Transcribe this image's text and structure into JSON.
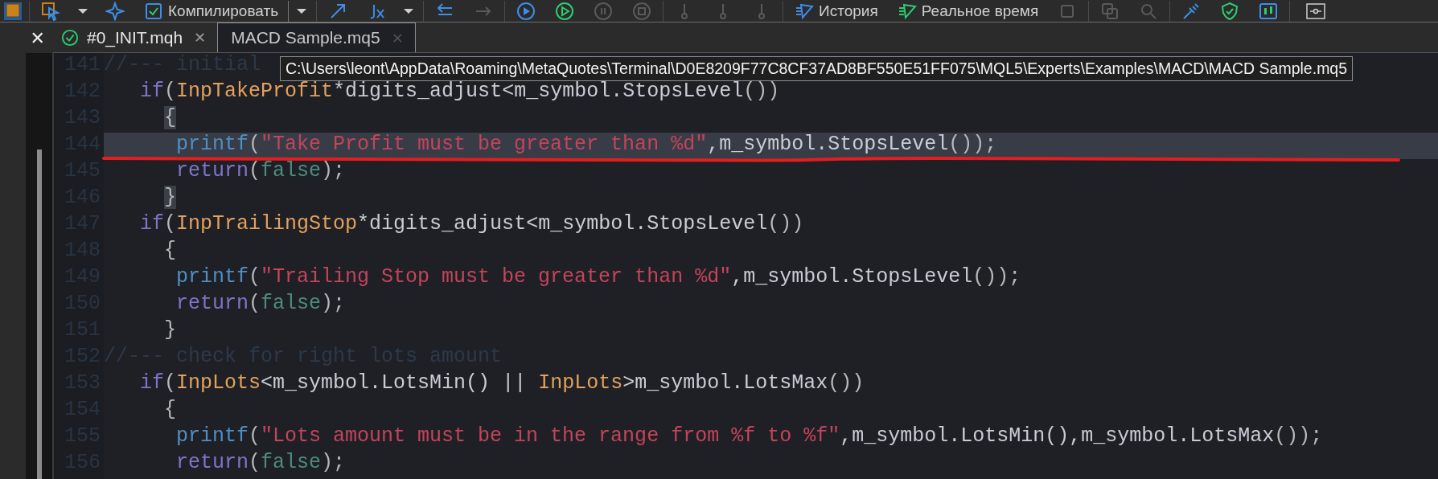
{
  "toolbar": {
    "items": [
      {
        "kind": "tile"
      },
      {
        "kind": "separator"
      },
      {
        "kind": "cursor",
        "disabled": false
      },
      {
        "kind": "caret",
        "disabled": false
      },
      {
        "kind": "sparkle",
        "disabled": false
      },
      {
        "kind": "compile",
        "label": "Компилировать",
        "disabled": false
      },
      {
        "kind": "split-caret",
        "disabled": false
      },
      {
        "kind": "separator"
      },
      {
        "kind": "arrow",
        "disabled": false
      },
      {
        "kind": "function",
        "disabled": false
      },
      {
        "kind": "caret",
        "disabled": false
      },
      {
        "kind": "separator"
      },
      {
        "kind": "back",
        "disabled": false
      },
      {
        "kind": "forward",
        "disabled": true
      },
      {
        "kind": "separator"
      },
      {
        "kind": "play",
        "disabled": false
      },
      {
        "kind": "play-green",
        "disabled": false
      },
      {
        "kind": "pause",
        "disabled": true
      },
      {
        "kind": "stop",
        "disabled": true
      },
      {
        "kind": "separator"
      },
      {
        "kind": "step",
        "disabled": true
      },
      {
        "kind": "step",
        "disabled": true
      },
      {
        "kind": "step",
        "disabled": true
      },
      {
        "kind": "separator"
      },
      {
        "kind": "history",
        "label": "История",
        "disabled": false
      },
      {
        "kind": "realtime",
        "label": "Реальное время",
        "disabled": false
      },
      {
        "kind": "square",
        "disabled": true
      },
      {
        "kind": "separator"
      },
      {
        "kind": "copy",
        "disabled": true
      },
      {
        "kind": "search",
        "disabled": true
      },
      {
        "kind": "separator"
      },
      {
        "kind": "brush",
        "disabled": false
      },
      {
        "kind": "shield",
        "disabled": false
      },
      {
        "kind": "chart",
        "disabled": false
      },
      {
        "kind": "separator"
      },
      {
        "kind": "box"
      }
    ]
  },
  "side_panel": {
    "close": "✕"
  },
  "tabs": [
    {
      "label": "#0_INIT.mqh",
      "close": "✕",
      "selected": false,
      "compiled": true
    },
    {
      "label": "MACD Sample.mq5",
      "close": "✕",
      "selected": true,
      "compiled": false
    }
  ],
  "tooltip": "C:\\Users\\leont\\AppData\\Roaming\\MetaQuotes\\Terminal\\D0E8209F77C8CF37AD8BF550E51FF075\\MQL5\\Experts\\Examples\\MACD\\MACD Sample.mq5",
  "editor": {
    "lines": [
      {
        "number": "141",
        "current": false,
        "tokens": [
          {
            "kind": "comment",
            "text": "//--- initial"
          }
        ]
      },
      {
        "number": "142",
        "current": false,
        "tokens": [
          {
            "kind": "keyword",
            "text": "   if"
          },
          {
            "kind": "paren",
            "text": "("
          },
          {
            "kind": "input",
            "text": "InpTakeProfit"
          },
          {
            "kind": "plain",
            "text": "*digits_adjust<m_symbol.StopsLevel"
          },
          {
            "kind": "paren",
            "text": "())"
          }
        ]
      },
      {
        "number": "143",
        "current": false,
        "tokens": [
          {
            "kind": "brace-match",
            "text": "     {"
          }
        ]
      },
      {
        "number": "144",
        "current": true,
        "tokens": [
          {
            "kind": "function",
            "text": "      printf"
          },
          {
            "kind": "paren",
            "text": "("
          },
          {
            "kind": "string",
            "text": "\"Take Profit must be greater than %d\""
          },
          {
            "kind": "plain",
            "text": ",m_symbol.StopsLevel"
          },
          {
            "kind": "paren",
            "text": "());"
          }
        ]
      },
      {
        "number": "145",
        "current": false,
        "tokens": [
          {
            "kind": "keyword",
            "text": "      return"
          },
          {
            "kind": "paren",
            "text": "("
          },
          {
            "kind": "bool",
            "text": "false"
          },
          {
            "kind": "paren",
            "text": ");"
          }
        ]
      },
      {
        "number": "146",
        "current": false,
        "tokens": [
          {
            "kind": "brace-match",
            "text": "     }"
          }
        ]
      },
      {
        "number": "147",
        "current": false,
        "tokens": [
          {
            "kind": "keyword",
            "text": "   if"
          },
          {
            "kind": "paren",
            "text": "("
          },
          {
            "kind": "input",
            "text": "InpTrailingStop"
          },
          {
            "kind": "plain",
            "text": "*digits_adjust<m_symbol.StopsLevel"
          },
          {
            "kind": "paren",
            "text": "())"
          }
        ]
      },
      {
        "number": "148",
        "current": false,
        "tokens": [
          {
            "kind": "paren",
            "text": "     {"
          }
        ]
      },
      {
        "number": "149",
        "current": false,
        "tokens": [
          {
            "kind": "function",
            "text": "      printf"
          },
          {
            "kind": "paren",
            "text": "("
          },
          {
            "kind": "string",
            "text": "\"Trailing Stop must be greater than %d\""
          },
          {
            "kind": "plain",
            "text": ",m_symbol.StopsLevel"
          },
          {
            "kind": "paren",
            "text": "());"
          }
        ]
      },
      {
        "number": "150",
        "current": false,
        "tokens": [
          {
            "kind": "keyword",
            "text": "      return"
          },
          {
            "kind": "paren",
            "text": "("
          },
          {
            "kind": "bool",
            "text": "false"
          },
          {
            "kind": "paren",
            "text": ");"
          }
        ]
      },
      {
        "number": "151",
        "current": false,
        "tokens": [
          {
            "kind": "paren",
            "text": "     }"
          }
        ]
      },
      {
        "number": "152",
        "current": false,
        "tokens": [
          {
            "kind": "comment",
            "text": "//--- check for right lots amount"
          }
        ]
      },
      {
        "number": "153",
        "current": false,
        "tokens": [
          {
            "kind": "keyword",
            "text": "   if"
          },
          {
            "kind": "paren",
            "text": "("
          },
          {
            "kind": "input",
            "text": "InpLots"
          },
          {
            "kind": "plain",
            "text": "<m_symbol.LotsMin() || "
          },
          {
            "kind": "input",
            "text": "InpLots"
          },
          {
            "kind": "plain",
            "text": ">m_symbol.LotsMax"
          },
          {
            "kind": "paren",
            "text": "())"
          }
        ]
      },
      {
        "number": "154",
        "current": false,
        "tokens": [
          {
            "kind": "paren",
            "text": "     {"
          }
        ]
      },
      {
        "number": "155",
        "current": false,
        "tokens": [
          {
            "kind": "function",
            "text": "      printf"
          },
          {
            "kind": "paren",
            "text": "("
          },
          {
            "kind": "string",
            "text": "\"Lots amount must be in the range from %f to %f\""
          },
          {
            "kind": "plain",
            "text": ",m_symbol.LotsMin(),m_symbol.LotsMax"
          },
          {
            "kind": "paren",
            "text": "());"
          }
        ]
      },
      {
        "number": "156",
        "current": false,
        "tokens": [
          {
            "kind": "keyword",
            "text": "      return"
          },
          {
            "kind": "paren",
            "text": "("
          },
          {
            "kind": "bool",
            "text": "false"
          },
          {
            "kind": "paren",
            "text": ");"
          }
        ]
      }
    ]
  }
}
